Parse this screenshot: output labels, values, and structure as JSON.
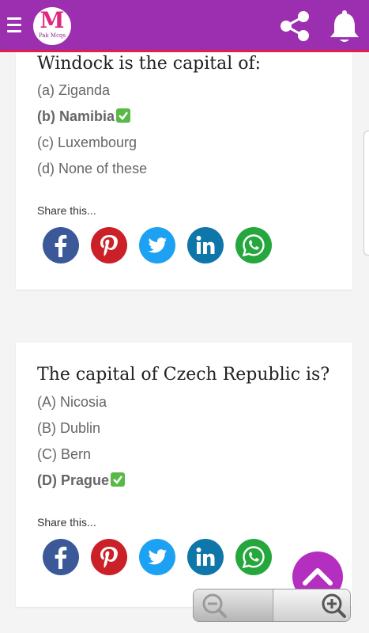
{
  "header": {
    "logo_mark": "M",
    "logo_name": "Pak Mcqs"
  },
  "questions": [
    {
      "question": "Windock is the capital of:",
      "options": [
        "(a) Ziganda",
        "(b) Namibia",
        "(c) Luxembourg",
        "(d) None of these"
      ],
      "correct_index": 1,
      "share_label": "Share this..."
    },
    {
      "question": "The capital of Czech Republic is?",
      "options": [
        "(A) Nicosia",
        "(B) Dublin",
        "(C) Bern",
        "(D) Prague"
      ],
      "correct_index": 3,
      "share_label": "Share this..."
    }
  ],
  "social_icons": [
    "facebook-icon",
    "pinterest-icon",
    "twitter-icon",
    "linkedin-icon",
    "whatsapp-icon"
  ],
  "colors": {
    "toolbar": "#9b2fb0",
    "toolbar_underline": "#e0204a",
    "facebook": "#3b5998",
    "pinterest": "#cb2027",
    "twitter": "#1da1f2",
    "linkedin": "#0e76a8",
    "whatsapp": "#25d366",
    "correct_check": "#58b947",
    "scroll_top_fab": "#b42fbf"
  }
}
